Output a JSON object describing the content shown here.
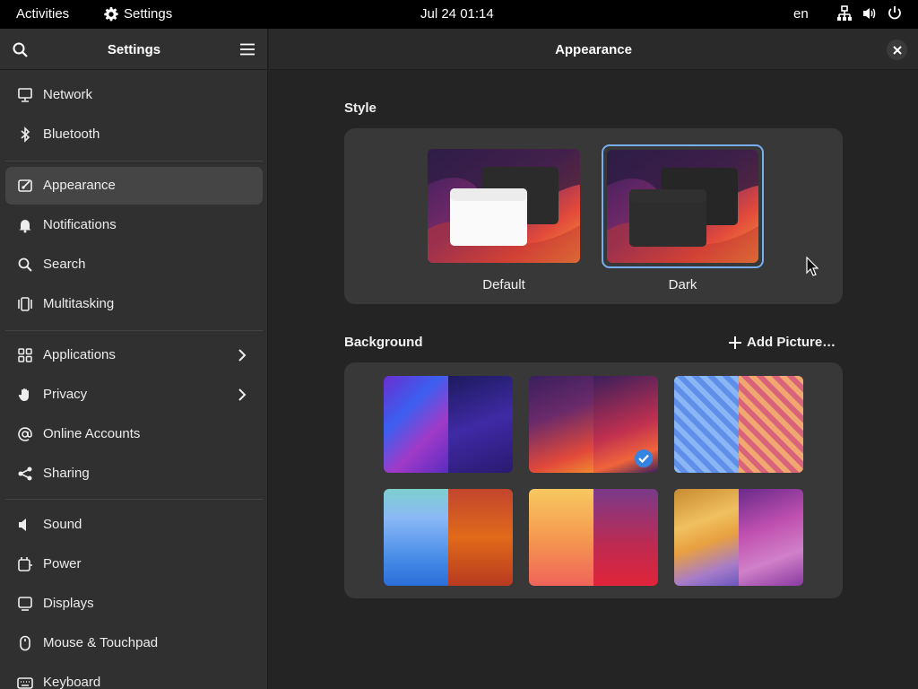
{
  "topbar": {
    "activities": "Activities",
    "app_name": "Settings",
    "clock": "Jul 24  01:14",
    "language": "en"
  },
  "sidebar": {
    "title": "Settings",
    "items": [
      {
        "label": "Network",
        "icon": "network-icon"
      },
      {
        "label": "Bluetooth",
        "icon": "bluetooth-icon"
      },
      {
        "label": "Appearance",
        "icon": "appearance-icon",
        "active": true
      },
      {
        "label": "Notifications",
        "icon": "bell-icon"
      },
      {
        "label": "Search",
        "icon": "search-icon"
      },
      {
        "label": "Multitasking",
        "icon": "multitasking-icon"
      },
      {
        "label": "Applications",
        "icon": "applications-icon",
        "has_arrow": true
      },
      {
        "label": "Privacy",
        "icon": "hand-icon",
        "has_arrow": true
      },
      {
        "label": "Online Accounts",
        "icon": "at-icon"
      },
      {
        "label": "Sharing",
        "icon": "share-icon"
      },
      {
        "label": "Sound",
        "icon": "speaker-icon"
      },
      {
        "label": "Power",
        "icon": "power-icon"
      },
      {
        "label": "Displays",
        "icon": "display-icon"
      },
      {
        "label": "Mouse & Touchpad",
        "icon": "mouse-icon"
      },
      {
        "label": "Keyboard",
        "icon": "keyboard-icon"
      }
    ]
  },
  "content": {
    "title": "Appearance",
    "style": {
      "section_title": "Style",
      "options": [
        {
          "label": "Default",
          "selected": false
        },
        {
          "label": "Dark",
          "selected": true
        }
      ]
    },
    "background": {
      "section_title": "Background",
      "add_picture_label": "Add Picture…",
      "selected_index": 1
    }
  },
  "colors": {
    "accent": "#78aeed",
    "sidebar_bg": "#303030",
    "content_bg": "#242424",
    "panel_bg": "#383838",
    "active_item": "#454545",
    "check_blue": "#3584e4"
  }
}
